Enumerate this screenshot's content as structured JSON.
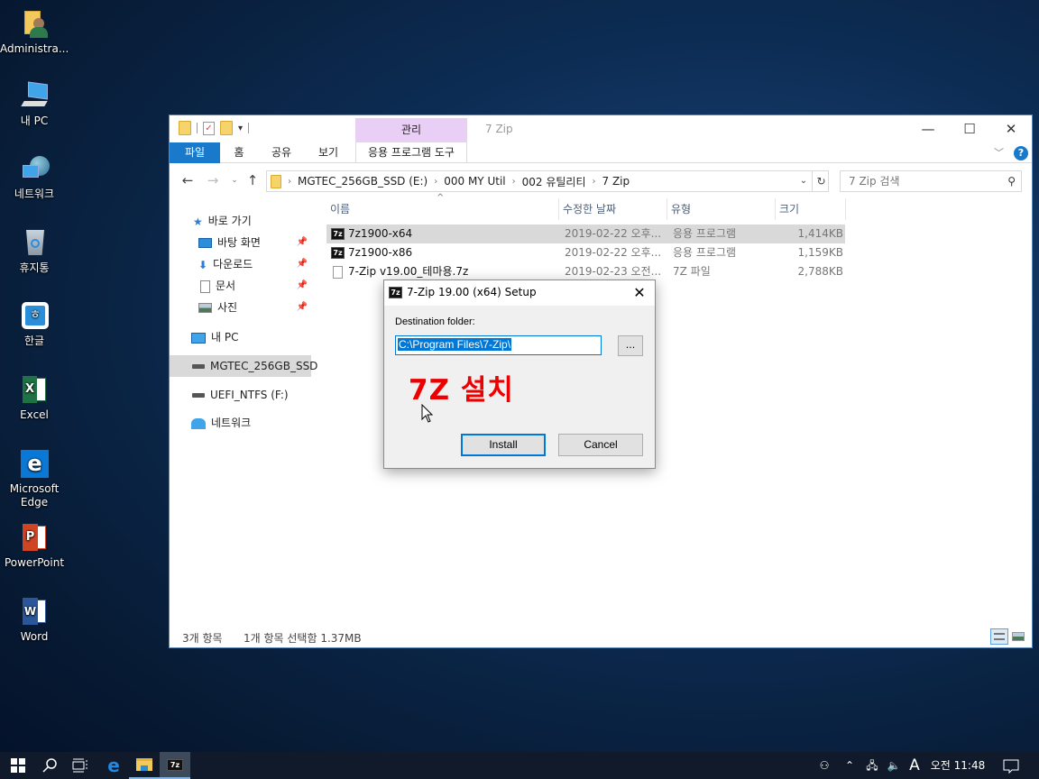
{
  "desktop": {
    "icons": [
      {
        "label": "Administra...",
        "icon": "user-folder-icon"
      },
      {
        "label": "내 PC",
        "icon": "this-pc-icon"
      },
      {
        "label": "네트워크",
        "icon": "network-icon"
      },
      {
        "label": "휴지통",
        "icon": "recycle-bin-icon"
      },
      {
        "label": "한글",
        "icon": "hangul-icon"
      },
      {
        "label": "Excel",
        "icon": "excel-icon"
      },
      {
        "label": "Microsoft Edge",
        "icon": "edge-icon"
      },
      {
        "label": "PowerPoint",
        "icon": "powerpoint-icon"
      },
      {
        "label": "Word",
        "icon": "word-icon"
      }
    ]
  },
  "explorer": {
    "title": "7 Zip",
    "context_tab_header": "관리",
    "ribbon_tabs": [
      "파일",
      "홈",
      "공유",
      "보기",
      "응용 프로그램 도구"
    ],
    "address": {
      "crumbs": [
        "MGTEC_256GB_SSD (E:)",
        "000 MY Util",
        "002 유틸리티",
        "7 Zip"
      ]
    },
    "search_placeholder": "7 Zip 검색",
    "nav": {
      "quick_access": "바로 가기",
      "pinned": [
        "바탕 화면",
        "다운로드",
        "문서",
        "사진"
      ],
      "this_pc": "내 PC",
      "drives": [
        "MGTEC_256GB_SSD",
        "UEFI_NTFS (F:)"
      ],
      "network": "네트워크"
    },
    "columns": {
      "name": "이름",
      "modified": "수정한 날짜",
      "type": "유형",
      "size": "크기"
    },
    "files": [
      {
        "name": "7z1900-x64",
        "modified": "2019-02-22 오후...",
        "type": "응용 프로그램",
        "size": "1,414KB",
        "icon": "7zip-icon",
        "selected": true
      },
      {
        "name": "7z1900-x86",
        "modified": "2019-02-22 오후...",
        "type": "응용 프로그램",
        "size": "1,159KB",
        "icon": "7zip-icon",
        "selected": false
      },
      {
        "name": "7-Zip v19.00_테마용.7z",
        "modified": "2019-02-23 오전...",
        "type": "7Z 파일",
        "size": "2,788KB",
        "icon": "file-icon",
        "selected": false
      }
    ],
    "status": {
      "count": "3개 항목",
      "selection": "1개 항목 선택함 1.37MB"
    }
  },
  "dialog": {
    "title": "7-Zip 19.00 (x64) Setup",
    "dest_label": "Destination folder:",
    "dest_value": "C:\\Program Files\\7-Zip\\",
    "browse_label": "...",
    "annotation": "7Z 설치",
    "install_label": "Install",
    "cancel_label": "Cancel"
  },
  "taskbar": {
    "clock": "오전 11:48",
    "ime": "A"
  }
}
